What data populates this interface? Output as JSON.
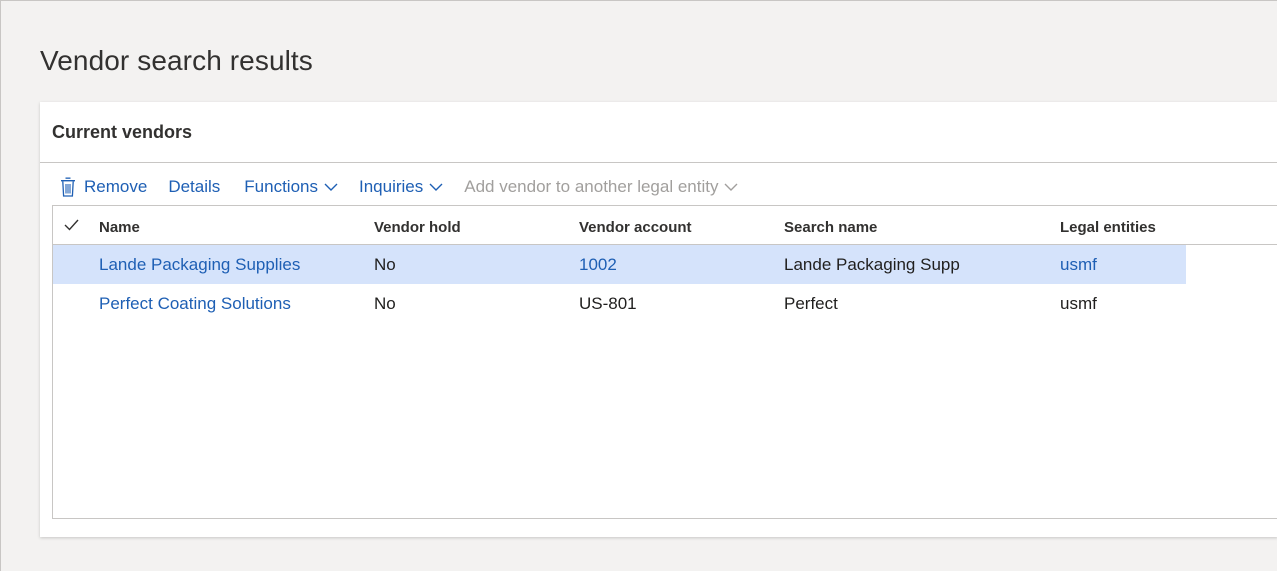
{
  "page": {
    "title": "Vendor search results"
  },
  "card": {
    "title": "Current vendors"
  },
  "toolbar": {
    "remove_label": "Remove",
    "details_label": "Details",
    "functions_label": "Functions",
    "inquiries_label": "Inquiries",
    "add_vendor_label": "Add vendor to another legal entity",
    "remove_icon": "trash-icon",
    "dropdown_icon": "chevron-down-icon"
  },
  "grid": {
    "columns": [
      "Name",
      "Vendor hold",
      "Vendor account",
      "Search name",
      "Legal entities"
    ],
    "rows": [
      {
        "name": "Lande Packaging Supplies",
        "vendor_hold": "No",
        "vendor_account": "1002",
        "search_name": "Lande Packaging Supp",
        "legal_entities": "usmf",
        "selected": true
      },
      {
        "name": "Perfect Coating Solutions",
        "vendor_hold": "No",
        "vendor_account": "US-801",
        "search_name": "Perfect",
        "legal_entities": "usmf",
        "selected": false
      }
    ]
  },
  "colors": {
    "link": "#1e5fb4",
    "selected_row": "#d5e3fb",
    "disabled": "#a19f9d",
    "background": "#f3f2f1"
  }
}
